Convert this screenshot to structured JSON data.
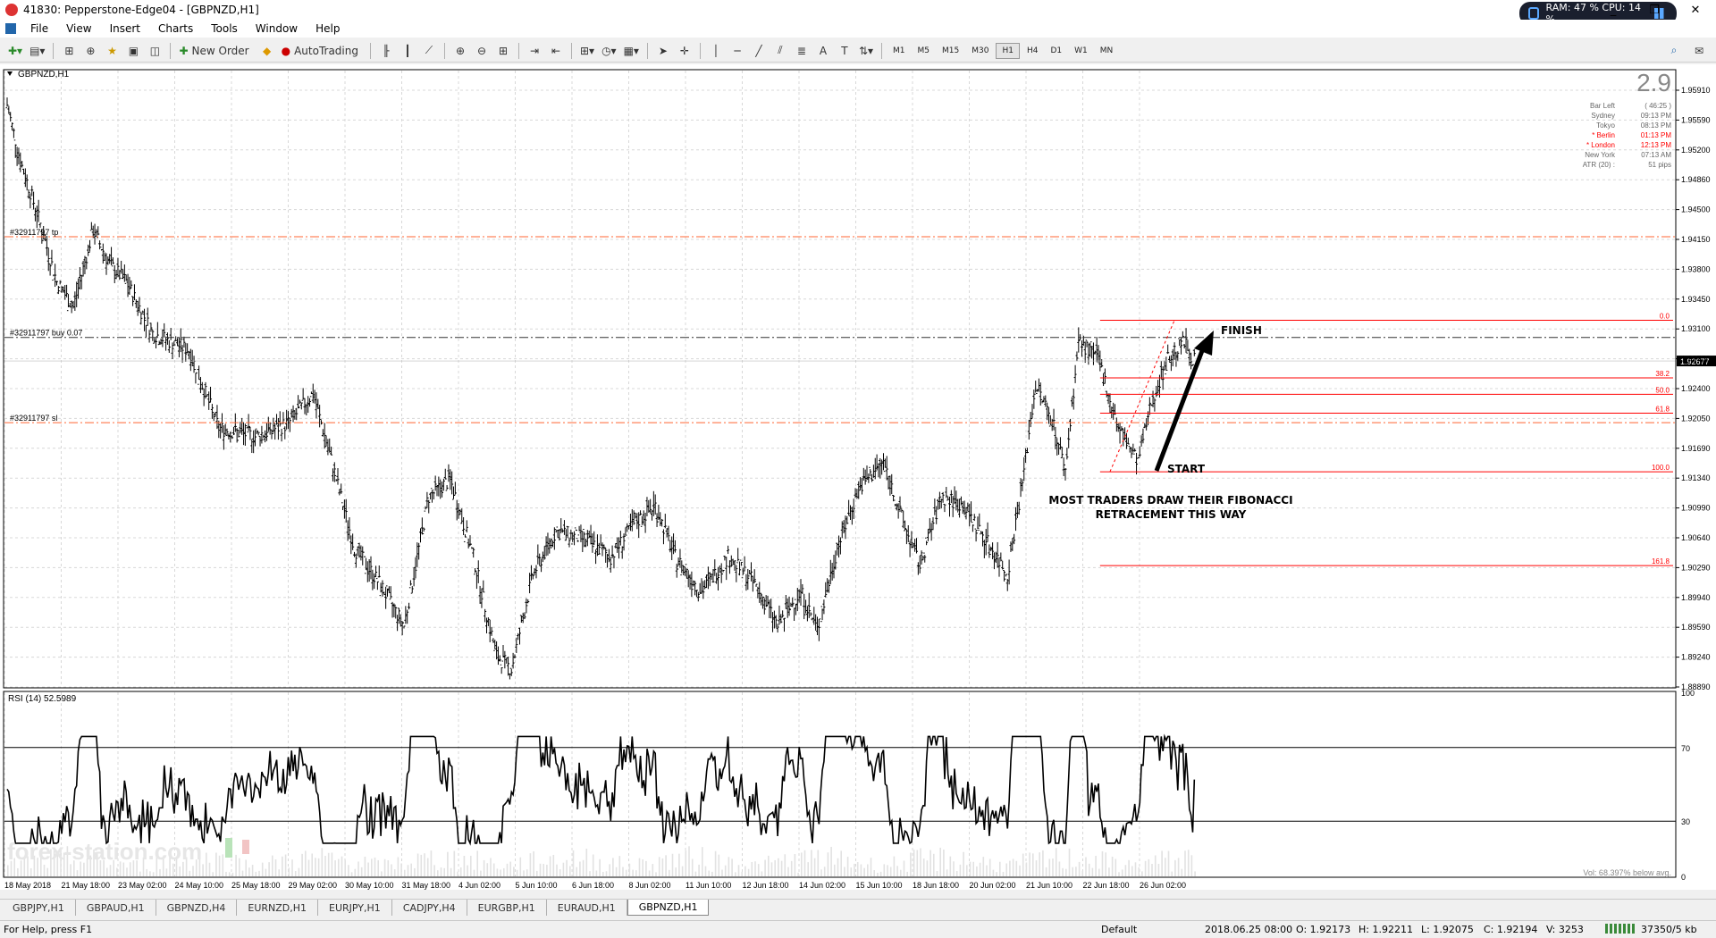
{
  "window": {
    "title": "41830: Pepperstone-Edge04 - [GBPNZD,H1]",
    "controls": [
      "_",
      "❐",
      "✕"
    ]
  },
  "sysmon": {
    "text": "RAM: 47 %  CPU: 14 %"
  },
  "menu": [
    "File",
    "View",
    "Insert",
    "Charts",
    "Tools",
    "Window",
    "Help"
  ],
  "toolbar": {
    "new_order": "New Order",
    "autotrading": "AutoTrading",
    "timeframes": [
      "M1",
      "M5",
      "M15",
      "M30",
      "H1",
      "H4",
      "D1",
      "W1",
      "MN"
    ],
    "active_timeframe": "H1"
  },
  "chart": {
    "symbol_label": "GBPNZD,H1",
    "rsi_label": "RSI (14) 52.5989",
    "watermark": "forex-station.com",
    "vol_note": "Vol: 68.397% below avg.",
    "info_panel": {
      "big_number": "2.9",
      "rows": [
        {
          "label": "Bar Left",
          "value": "( 46:25 )",
          "color": "#666666"
        },
        {
          "label": "Sydney",
          "value": "09:13 PM",
          "color": "#666666"
        },
        {
          "label": "Tokyo",
          "value": "08:13 PM",
          "color": "#666666"
        },
        {
          "label": "* Berlin",
          "value": "01:13 PM",
          "color": "#ff0000"
        },
        {
          "label": "* London",
          "value": "12:13 PM",
          "color": "#ff0000"
        },
        {
          "label": "New York",
          "value": "07:13 AM",
          "color": "#666666"
        },
        {
          "label": "ATR (20) :",
          "value": "51 pips",
          "color": "#666666"
        }
      ]
    },
    "trade_lines": [
      {
        "label": "#32911797 tp",
        "price": 1.9412,
        "color": "#ff6633",
        "style": "dashdot"
      },
      {
        "label": "#32911797 buy 0.07",
        "price": 1.9295,
        "color": "#333333",
        "style": "dashdot"
      },
      {
        "label": "#32911797 sl",
        "price": 1.9196,
        "color": "#ff6633",
        "style": "dashdot"
      }
    ],
    "current_price": "1.92677",
    "annotations": {
      "finish": "FINISH",
      "start": "START",
      "note_line1": "MOST TRADERS DRAW THEIR FIBONACCI",
      "note_line2": "RETRACEMENT THIS WAY"
    }
  },
  "chart_data": {
    "type": "candlestick",
    "price_axis": {
      "ylim": [
        1.8889,
        1.9605
      ],
      "ticks": [
        "1.95910",
        "1.95590",
        "1.95200",
        "1.94860",
        "1.94500",
        "1.94150",
        "1.93800",
        "1.93450",
        "1.93100",
        "1.92750",
        "1.92400",
        "1.92050",
        "1.91690",
        "1.91340",
        "1.90990",
        "1.90640",
        "1.90290",
        "1.89940",
        "1.89590",
        "1.89240",
        "1.88890"
      ]
    },
    "time_axis": {
      "labels": [
        "18 May 2018",
        "21 May 18:00",
        "23 May 02:00",
        "24 May 10:00",
        "25 May 18:00",
        "29 May 02:00",
        "30 May 10:00",
        "31 May 18:00",
        "4 Jun 02:00",
        "5 Jun 10:00",
        "6 Jun 18:00",
        "8 Jun 02:00",
        "11 Jun 10:00",
        "12 Jun 18:00",
        "14 Jun 02:00",
        "15 Jun 10:00",
        "18 Jun 18:00",
        "20 Jun 02:00",
        "21 Jun 10:00",
        "22 Jun 18:00",
        "26 Jun 02:00"
      ]
    },
    "price_path_keypoints": [
      [
        0,
        1.9565
      ],
      [
        8,
        1.95
      ],
      [
        18,
        1.944
      ],
      [
        30,
        1.936
      ],
      [
        40,
        1.933
      ],
      [
        52,
        1.942
      ],
      [
        62,
        1.938
      ],
      [
        72,
        1.936
      ],
      [
        88,
        1.93
      ],
      [
        110,
        1.928
      ],
      [
        128,
        1.919
      ],
      [
        150,
        1.918
      ],
      [
        170,
        1.9195
      ],
      [
        185,
        1.923
      ],
      [
        195,
        1.916
      ],
      [
        210,
        1.905
      ],
      [
        225,
        1.901
      ],
      [
        240,
        1.896
      ],
      [
        255,
        1.911
      ],
      [
        268,
        1.913
      ],
      [
        282,
        1.904
      ],
      [
        296,
        1.8925
      ],
      [
        305,
        1.891
      ],
      [
        318,
        1.902
      ],
      [
        332,
        1.907
      ],
      [
        350,
        1.906
      ],
      [
        365,
        1.904
      ],
      [
        380,
        1.908
      ],
      [
        392,
        1.91
      ],
      [
        404,
        1.904
      ],
      [
        420,
        1.9
      ],
      [
        436,
        1.904
      ],
      [
        452,
        1.901
      ],
      [
        466,
        1.896
      ],
      [
        480,
        1.9
      ],
      [
        490,
        1.8955
      ],
      [
        502,
        1.905
      ],
      [
        515,
        1.912
      ],
      [
        530,
        1.915
      ],
      [
        542,
        1.908
      ],
      [
        552,
        1.903
      ],
      [
        565,
        1.911
      ],
      [
        578,
        1.91
      ],
      [
        592,
        1.906
      ],
      [
        605,
        1.902
      ],
      [
        615,
        1.914
      ],
      [
        622,
        1.924
      ],
      [
        632,
        1.92
      ],
      [
        640,
        1.914
      ],
      [
        648,
        1.929
      ],
      [
        660,
        1.927
      ],
      [
        672,
        1.919
      ],
      [
        684,
        1.915
      ],
      [
        692,
        1.922
      ],
      [
        702,
        1.927
      ],
      [
        712,
        1.929
      ],
      [
        718,
        1.9268
      ]
    ],
    "fibonacci": {
      "levels": [
        {
          "label": "0.0",
          "price": 1.9315
        },
        {
          "label": "38.2",
          "price": 1.9248
        },
        {
          "label": "50.0",
          "price": 1.9229
        },
        {
          "label": "61.8",
          "price": 1.9207
        },
        {
          "label": "100.0",
          "price": 1.9139
        },
        {
          "label": "161.8",
          "price": 1.903
        }
      ]
    },
    "rsi": {
      "label": "RSI (14) 52.5989",
      "ylim": [
        0,
        100
      ],
      "levels": [
        70,
        30
      ],
      "axis_ticks": [
        "100",
        "70",
        "30",
        "0"
      ],
      "current": 52.5989
    }
  },
  "tabs": [
    "GBPJPY,H1",
    "GBPAUD,H1",
    "GBPNZD,H4",
    "EURNZD,H1",
    "EURJPY,H1",
    "CADJPY,H4",
    "EURGBP,H1",
    "EURAUD,H1",
    "GBPNZD,H1"
  ],
  "active_tab": "GBPNZD,H1",
  "status": {
    "help": "For Help, press F1",
    "profile": "Default",
    "datetime": "2018.06.25 08:00",
    "open": "O: 1.92173",
    "high": "H: 1.92211",
    "low": "L: 1.92075",
    "close": "C: 1.92194",
    "volume": "V: 3253",
    "traffic": "37350/5 kb"
  }
}
